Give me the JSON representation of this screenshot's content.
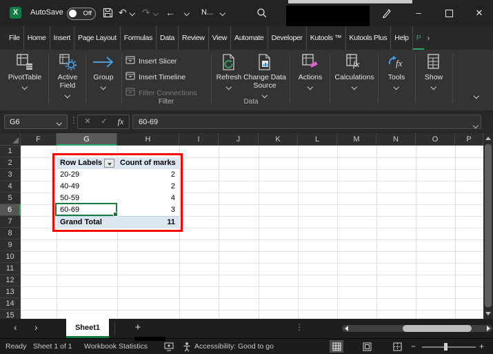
{
  "titlebar": {
    "autosave_label": "AutoSave",
    "autosave_state": "Off",
    "doc_name": "N..."
  },
  "icons": {
    "undo": "↶",
    "redo": "↷",
    "back": "←",
    "minimize": "–",
    "close": "✕",
    "cancel": "✕",
    "enter": "✓",
    "fx": "fx",
    "vertical_dots": "⋮",
    "nav_left": "‹",
    "nav_right": "›",
    "tab_overflow": "›",
    "add_sheet": "+"
  },
  "ribbon_tabs": {
    "tabs": [
      "File",
      "Home",
      "Insert",
      "Page Layout",
      "Formulas",
      "Data",
      "Review",
      "View",
      "Automate",
      "Developer",
      "Kutools ™",
      "Kutools Plus",
      "Help",
      "P"
    ],
    "active": "P"
  },
  "ribbon": {
    "pivottable_label": "PivotTable",
    "active_field_label": "Active Field",
    "group_label": "Group",
    "filter_group": {
      "label": "Filter",
      "items": [
        {
          "label": "Insert Slicer",
          "disabled": false
        },
        {
          "label": "Insert Timeline",
          "disabled": false
        },
        {
          "label": "Filter Connections",
          "disabled": true
        }
      ]
    },
    "data_group": {
      "label": "Data",
      "refresh_label": "Refresh",
      "change_data_source_label": "Change Data Source"
    },
    "big_buttons": [
      "Actions",
      "Calculations",
      "Tools",
      "Show"
    ]
  },
  "formula_bar": {
    "name_box": "G6",
    "formula": "60-69"
  },
  "grid": {
    "columns": [
      "F",
      "G",
      "H",
      "I",
      "J",
      "K",
      "L",
      "M",
      "N",
      "O",
      "P"
    ],
    "rows": [
      "1",
      "2",
      "3",
      "4",
      "5",
      "6",
      "7",
      "8",
      "9",
      "10",
      "11",
      "12",
      "13",
      "14",
      "15"
    ],
    "selected_column": "G",
    "selected_row": "6",
    "selected_cell": "G6"
  },
  "pivot_table": {
    "header": {
      "row_labels": "Row Labels",
      "count": "Count of marks"
    },
    "rows": [
      {
        "label": "20-29",
        "value": "2"
      },
      {
        "label": "40-49",
        "value": "2"
      },
      {
        "label": "50-59",
        "value": "4"
      },
      {
        "label": "60-69",
        "value": "3"
      }
    ],
    "grand_total": {
      "label": "Grand Total",
      "value": "11"
    }
  },
  "sheet_bar": {
    "sheet_tab": "Sheet1"
  },
  "status_bar": {
    "ready": "Ready",
    "sheet_info": "Sheet 1 of 1",
    "workbook_statistics": "Workbook Statistics",
    "accessibility": "Accessibility: Good to go"
  },
  "colors": {
    "excel_green": "#107C41",
    "accent_green": "#2EA36B",
    "pivot_fill": "#DCE6F1",
    "annotation_red": "#FF0000",
    "ribbon_icon_blue": "#4A9EDE"
  }
}
